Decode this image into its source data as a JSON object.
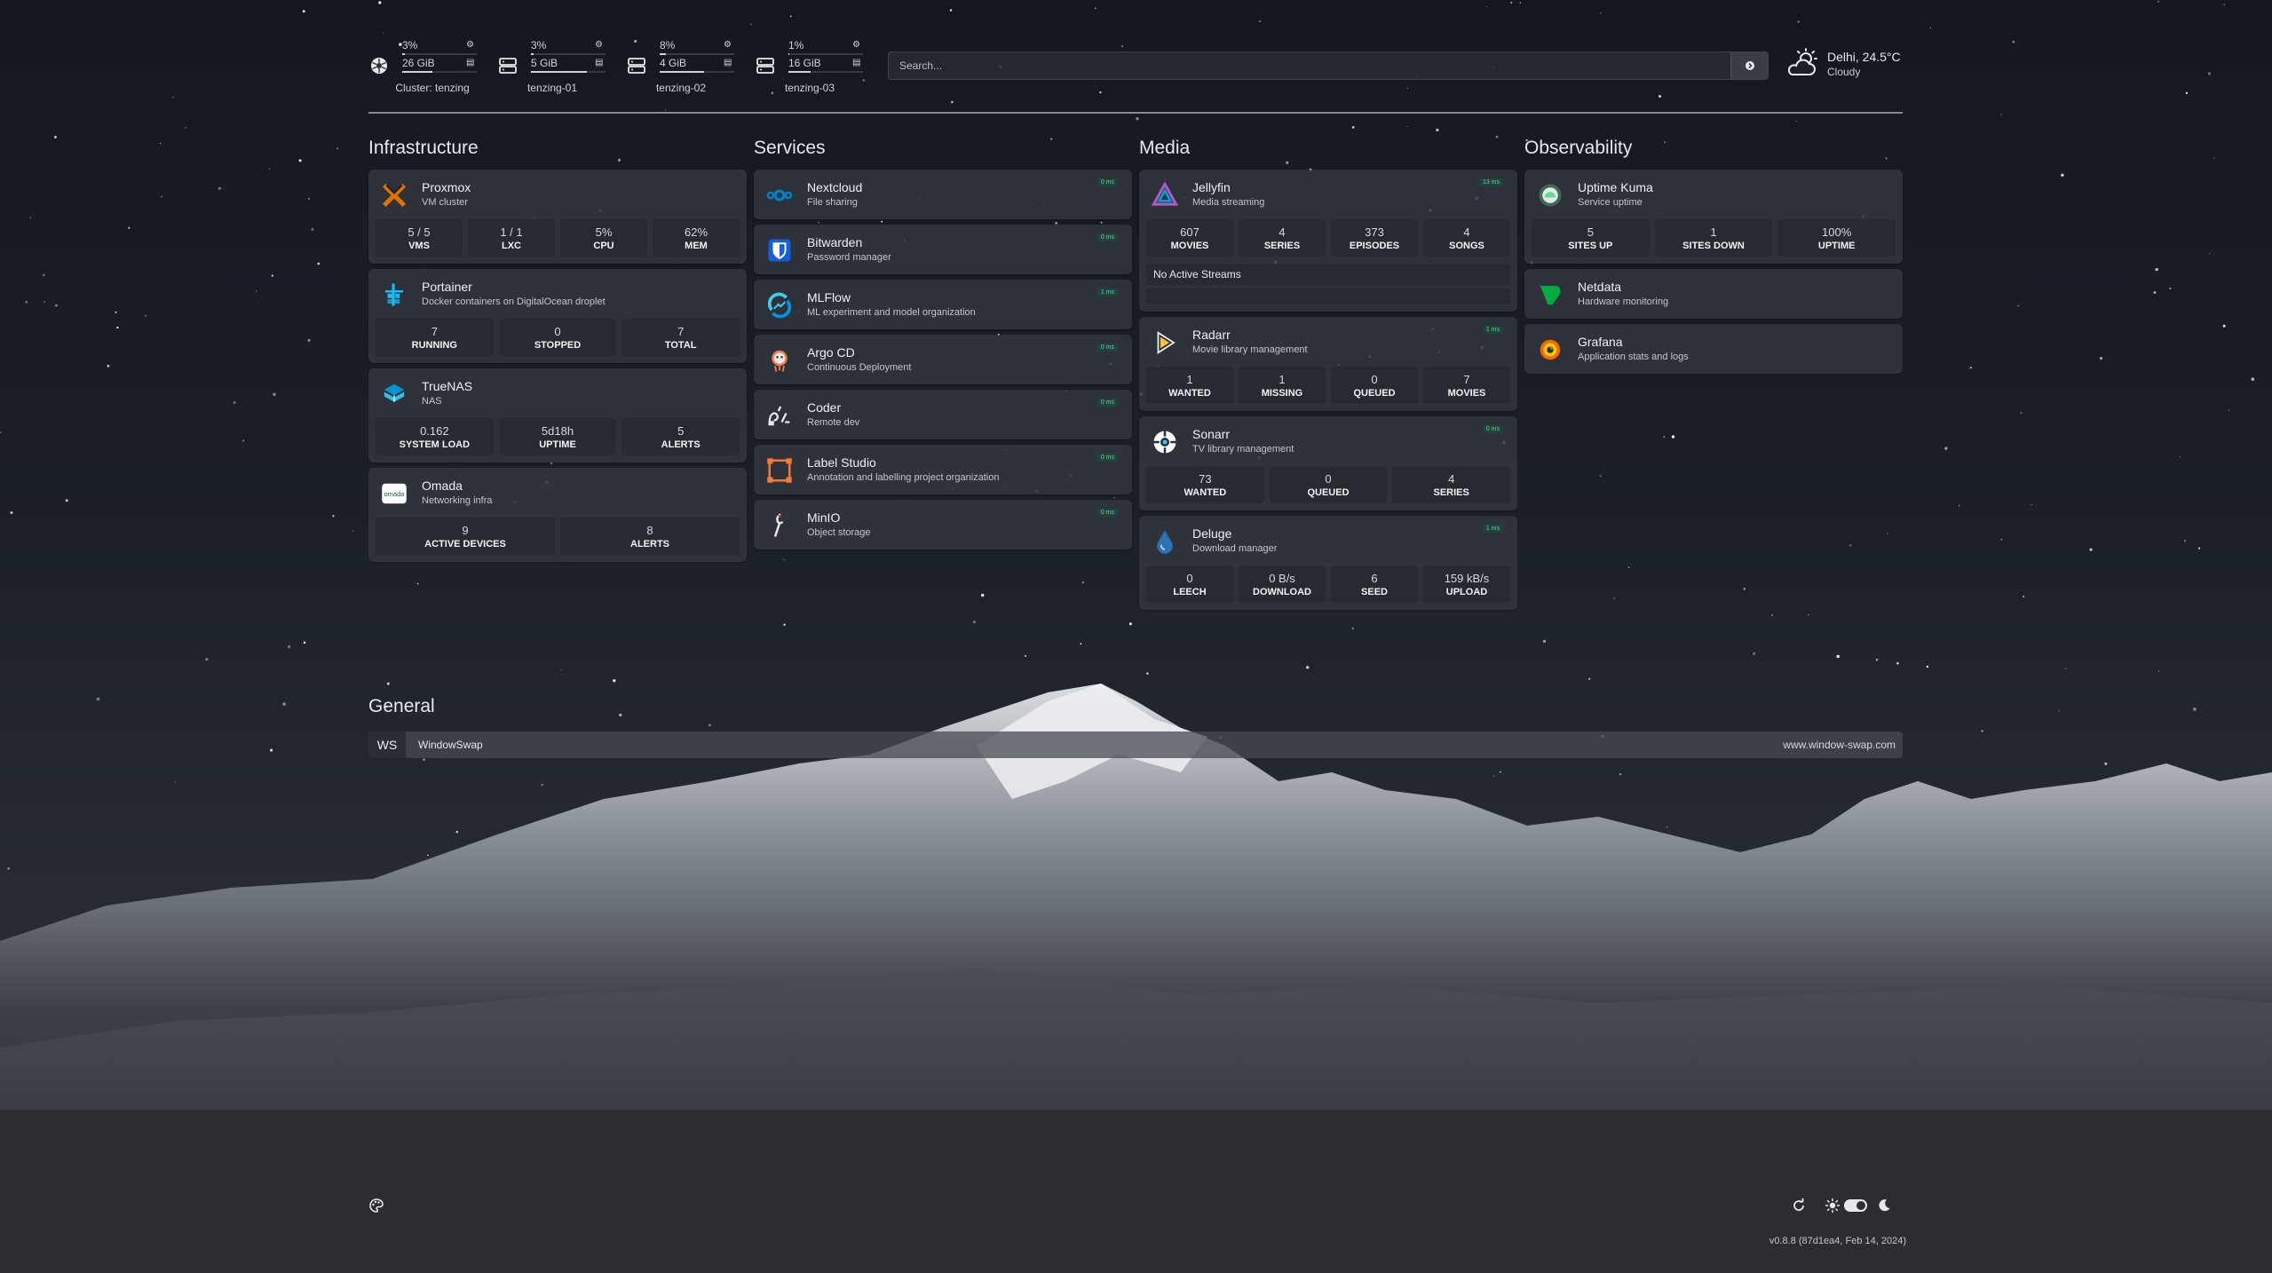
{
  "resources": [
    {
      "cpu": "3%",
      "mem": "26 GiB",
      "label": "Cluster: tenzing",
      "cpu_frac": 0.03,
      "mem_frac": 0.4,
      "icon": "kubernetes-icon"
    },
    {
      "cpu": "3%",
      "mem": "5 GiB",
      "label": "tenzing-01",
      "cpu_frac": 0.03,
      "mem_frac": 0.75,
      "icon": "server-icon"
    },
    {
      "cpu": "8%",
      "mem": "4 GiB",
      "label": "tenzing-02",
      "cpu_frac": 0.08,
      "mem_frac": 0.6,
      "icon": "server-icon"
    },
    {
      "cpu": "1%",
      "mem": "16 GiB",
      "label": "tenzing-03",
      "cpu_frac": 0.01,
      "mem_frac": 0.3,
      "icon": "server-icon"
    }
  ],
  "search": {
    "placeholder": "Search..."
  },
  "weather": {
    "location": "Delhi, 24.5°C",
    "condition": "Cloudy",
    "icon": "partly-cloudy-icon"
  },
  "sections": {
    "infrastructure": {
      "title": "Infrastructure",
      "cards": [
        {
          "name": "Proxmox",
          "desc": "VM cluster",
          "icon": "proxmox-icon",
          "stats": [
            {
              "v": "5 / 5",
              "l": "VMS"
            },
            {
              "v": "1 / 1",
              "l": "LXC"
            },
            {
              "v": "5%",
              "l": "CPU"
            },
            {
              "v": "62%",
              "l": "MEM"
            }
          ]
        },
        {
          "name": "Portainer",
          "desc": "Docker containers on DigitalOcean droplet",
          "icon": "portainer-icon",
          "stats": [
            {
              "v": "7",
              "l": "RUNNING"
            },
            {
              "v": "0",
              "l": "STOPPED"
            },
            {
              "v": "7",
              "l": "TOTAL"
            }
          ]
        },
        {
          "name": "TrueNAS",
          "desc": "NAS",
          "icon": "truenas-icon",
          "stats": [
            {
              "v": "0.162",
              "l": "SYSTEM LOAD"
            },
            {
              "v": "5d18h",
              "l": "UPTIME"
            },
            {
              "v": "5",
              "l": "ALERTS"
            }
          ]
        },
        {
          "name": "Omada",
          "desc": "Networking infra",
          "icon": "omada-icon",
          "icon_text": "omada",
          "stats": [
            {
              "v": "9",
              "l": "ACTIVE DEVICES"
            },
            {
              "v": "8",
              "l": "ALERTS"
            }
          ]
        }
      ]
    },
    "services": {
      "title": "Services",
      "cards": [
        {
          "name": "Nextcloud",
          "desc": "File sharing",
          "icon": "nextcloud-icon",
          "ping": "0 ms"
        },
        {
          "name": "Bitwarden",
          "desc": "Password manager",
          "icon": "bitwarden-icon",
          "ping": "0 ms"
        },
        {
          "name": "MLFlow",
          "desc": "ML experiment and model organization",
          "icon": "mlflow-icon",
          "ping": "1 ms"
        },
        {
          "name": "Argo CD",
          "desc": "Continuous Deployment",
          "icon": "argocd-icon",
          "ping": "0 ms"
        },
        {
          "name": "Coder",
          "desc": "Remote dev",
          "icon": "coder-icon",
          "ping": "0 ms"
        },
        {
          "name": "Label Studio",
          "desc": "Annotation and labelling project organization",
          "icon": "label-studio-icon",
          "ping": "0 ms"
        },
        {
          "name": "MinIO",
          "desc": "Object storage",
          "icon": "minio-icon",
          "ping": "0 ms"
        }
      ]
    },
    "media": {
      "title": "Media",
      "cards": [
        {
          "name": "Jellyfin",
          "desc": "Media streaming",
          "icon": "jellyfin-icon",
          "ping": "13 ms",
          "stats": [
            {
              "v": "607",
              "l": "MOVIES"
            },
            {
              "v": "4",
              "l": "SERIES"
            },
            {
              "v": "373",
              "l": "EPISODES"
            },
            {
              "v": "4",
              "l": "SONGS"
            }
          ],
          "streams": "No Active Streams"
        },
        {
          "name": "Radarr",
          "desc": "Movie library management",
          "icon": "radarr-icon",
          "ping": "1 ms",
          "stats": [
            {
              "v": "1",
              "l": "WANTED"
            },
            {
              "v": "1",
              "l": "MISSING"
            },
            {
              "v": "0",
              "l": "QUEUED"
            },
            {
              "v": "7",
              "l": "MOVIES"
            }
          ]
        },
        {
          "name": "Sonarr",
          "desc": "TV library management",
          "icon": "sonarr-icon",
          "ping": "0 ms",
          "stats": [
            {
              "v": "73",
              "l": "WANTED"
            },
            {
              "v": "0",
              "l": "QUEUED"
            },
            {
              "v": "4",
              "l": "SERIES"
            }
          ]
        },
        {
          "name": "Deluge",
          "desc": "Download manager",
          "icon": "deluge-icon",
          "ping": "1 ms",
          "stats": [
            {
              "v": "0",
              "l": "LEECH"
            },
            {
              "v": "0 B/s",
              "l": "DOWNLOAD"
            },
            {
              "v": "6",
              "l": "SEED"
            },
            {
              "v": "159 kB/s",
              "l": "UPLOAD"
            }
          ]
        }
      ]
    },
    "observability": {
      "title": "Observability",
      "cards": [
        {
          "name": "Uptime Kuma",
          "desc": "Service uptime",
          "icon": "uptime-kuma-icon",
          "stats": [
            {
              "v": "5",
              "l": "SITES UP"
            },
            {
              "v": "1",
              "l": "SITES DOWN"
            },
            {
              "v": "100%",
              "l": "UPTIME"
            }
          ]
        },
        {
          "name": "Netdata",
          "desc": "Hardware monitoring",
          "icon": "netdata-icon"
        },
        {
          "name": "Grafana",
          "desc": "Application stats and logs",
          "icon": "grafana-icon"
        }
      ]
    }
  },
  "general": {
    "title": "General",
    "bookmarks": [
      {
        "abbr": "WS",
        "name": "WindowSwap",
        "url": "www.window-swap.com"
      }
    ]
  },
  "footer": {
    "version": "v0.8.8 (87d1ea4, Feb 14, 2024)",
    "theme": "dark"
  }
}
